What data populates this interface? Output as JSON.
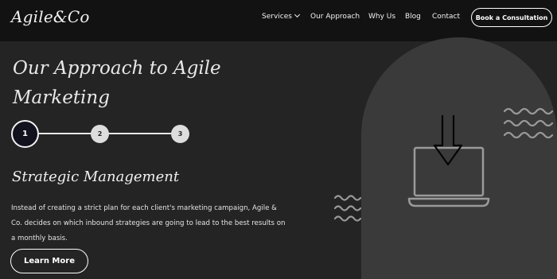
{
  "header": {
    "logo": "Agile&Co",
    "nav": [
      {
        "label": "Services"
      },
      {
        "label": "Our Approach"
      },
      {
        "label": "Why Us"
      },
      {
        "label": "Blog"
      },
      {
        "label": "Contact"
      }
    ],
    "cta_label": "Book a Consultation"
  },
  "main": {
    "title": "Our Approach to Agile Marketing",
    "steps": [
      "1",
      "2",
      "3"
    ],
    "active_step": 1,
    "section_heading": "Strategic Management",
    "section_body": "Instead of creating a strict plan for each client's marketing campaign, Agile & Co. decides on which inbound strategies are going to lead to the best results on a monthly basis.",
    "button_label": "Learn More"
  },
  "illustration": {
    "icon": "laptop-download-icon",
    "decoration": "wave-lines"
  },
  "colors": {
    "header_bg": "#121212",
    "page_bg": "#242424",
    "arch_bg": "#3a3a3a",
    "text": "#ffffff"
  }
}
